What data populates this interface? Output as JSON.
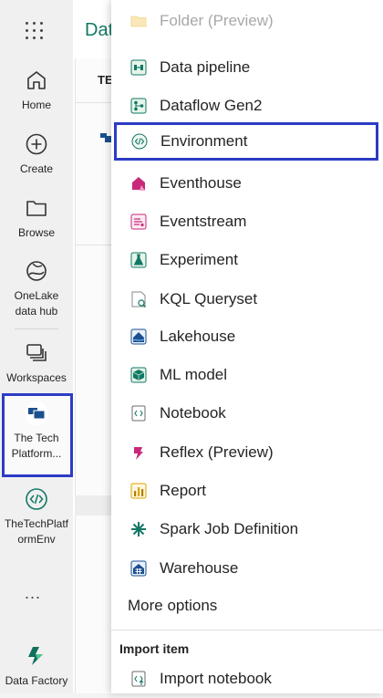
{
  "rail": {
    "items": [
      {
        "label": "Home",
        "icon": "home-icon"
      },
      {
        "label": "Create",
        "icon": "create-icon"
      },
      {
        "label": "Browse",
        "icon": "browse-icon"
      },
      {
        "label_line1": "OneLake",
        "label_line2": "data hub",
        "icon": "onelake-icon"
      },
      {
        "label": "Workspaces",
        "icon": "workspaces-icon"
      }
    ],
    "selected_workspace": {
      "line1": "The Tech",
      "line2": "Platform..."
    },
    "env_workspace": {
      "line1": "TheTechPlatf",
      "line2": "ormEnv"
    },
    "more": "...",
    "product": "Data Factory"
  },
  "page": {
    "title_fragment": "Dat",
    "column_fragment": "TE"
  },
  "menu": {
    "items": [
      {
        "label": "Folder (Preview)",
        "icon": "folder-icon",
        "disabled": true
      },
      {
        "label": "Data pipeline",
        "icon": "data-pipeline-icon"
      },
      {
        "label": "Dataflow Gen2",
        "icon": "dataflow-icon"
      },
      {
        "label": "Environment",
        "icon": "environment-icon",
        "highlighted": true
      },
      {
        "label": "Eventhouse",
        "icon": "eventhouse-icon"
      },
      {
        "label": "Eventstream",
        "icon": "eventstream-icon"
      },
      {
        "label": "Experiment",
        "icon": "experiment-icon"
      },
      {
        "label": "KQL Queryset",
        "icon": "kql-queryset-icon"
      },
      {
        "label": "Lakehouse",
        "icon": "lakehouse-icon"
      },
      {
        "label": "ML model",
        "icon": "ml-model-icon"
      },
      {
        "label": "Notebook",
        "icon": "notebook-icon"
      },
      {
        "label": "Reflex (Preview)",
        "icon": "reflex-icon"
      },
      {
        "label": "Report",
        "icon": "report-icon"
      },
      {
        "label": "Spark Job Definition",
        "icon": "spark-job-icon"
      },
      {
        "label": "Warehouse",
        "icon": "warehouse-icon"
      }
    ],
    "more_options": "More options",
    "import_section": {
      "heading": "Import item",
      "items": [
        {
          "label": "Import notebook",
          "icon": "import-notebook-icon"
        }
      ]
    }
  },
  "colors": {
    "highlight_border": "#2c3cc4",
    "brand_green": "#117865",
    "pink": "#c8287a",
    "navy": "#1b4f8f"
  }
}
